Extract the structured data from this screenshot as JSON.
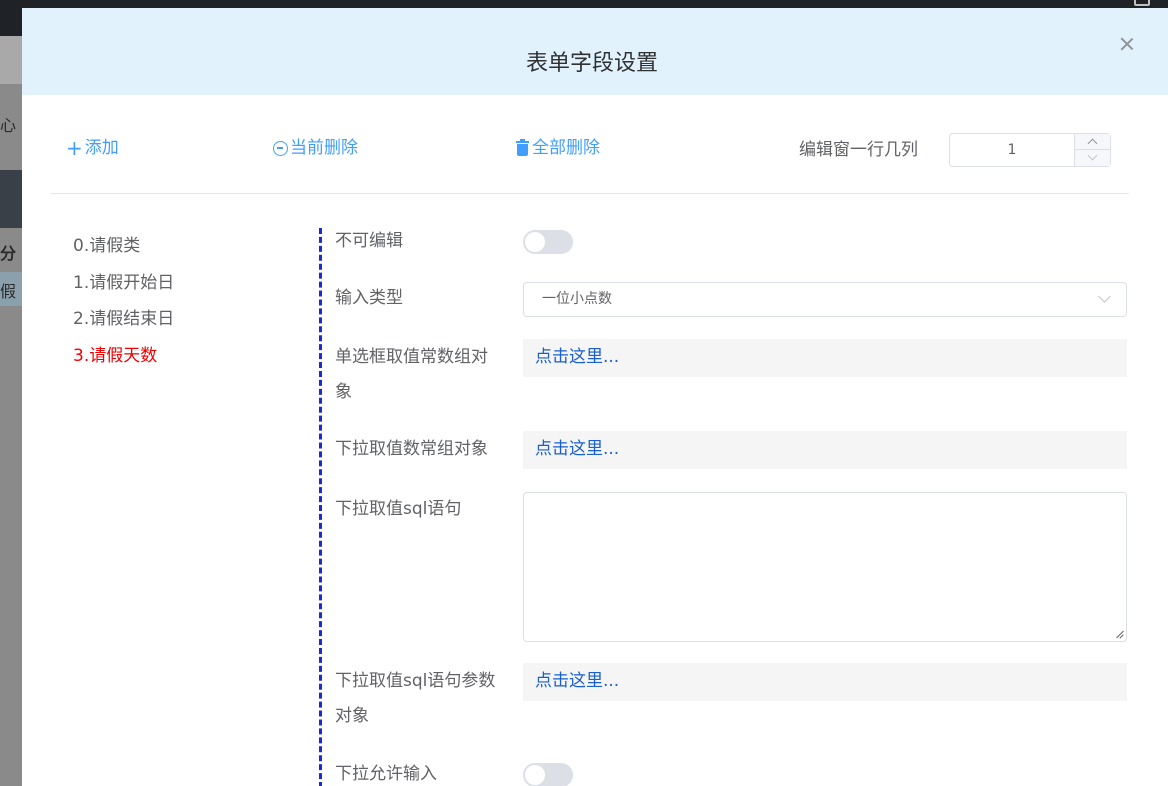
{
  "background": {
    "sidebar_fragment": "心",
    "column_fragment": "分",
    "row_fragment": "假"
  },
  "modal": {
    "title": "表单字段设置"
  },
  "toolbar": {
    "add_label": "添加",
    "delete_current_label": "当前删除",
    "delete_all_label": "全部删除",
    "columns_label": "编辑窗一行几列",
    "columns_value": "1"
  },
  "fields": {
    "items": [
      {
        "label": "0.请假类"
      },
      {
        "label": "1.请假开始日"
      },
      {
        "label": "2.请假结束日"
      },
      {
        "label": "3.请假天数"
      }
    ],
    "active_index": 3
  },
  "form": {
    "not_editable": {
      "label": "不可编辑",
      "value": false
    },
    "input_type": {
      "label": "输入类型",
      "value": "一位小点数"
    },
    "radio_constant": {
      "label_line1": "单选框取值常数组对",
      "label_line2": "象",
      "link_text": "点击这里..."
    },
    "dropdown_constant": {
      "label": "下拉取值数常组对象",
      "link_text": "点击这里..."
    },
    "dropdown_sql": {
      "label": "下拉取值sql语句",
      "value": ""
    },
    "dropdown_sql_params": {
      "label_line1": "下拉取值sql语句参数",
      "label_line2": "对象",
      "link_text": "点击这里..."
    },
    "dropdown_allow_input": {
      "label": "下拉允许输入",
      "value": false
    }
  },
  "colors": {
    "accent": "#409eff",
    "active_item": "#f00000",
    "link": "#1a5fd0",
    "header_bg": "#e1f2fd",
    "divider_dash": "#1a2bd6"
  }
}
